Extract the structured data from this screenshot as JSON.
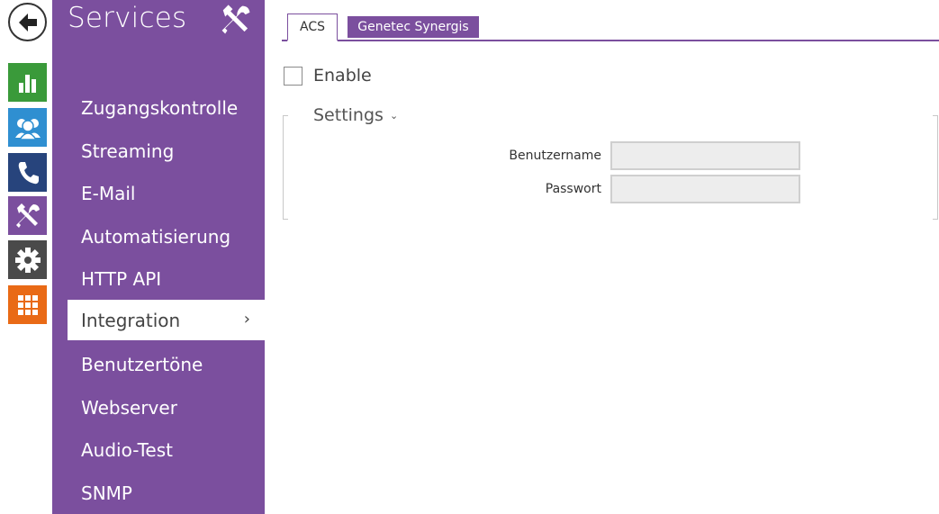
{
  "rail": {
    "back": {
      "icon": "back-arrow-icon"
    },
    "buttons": [
      {
        "icon": "status-chart-icon",
        "color": "#3a9a3a"
      },
      {
        "icon": "users-icon",
        "color": "#2f8fd1"
      },
      {
        "icon": "phone-icon",
        "color": "#27447c"
      },
      {
        "icon": "services-tools-icon",
        "color": "#7b4f9e"
      },
      {
        "icon": "system-gear-icon",
        "color": "#4a4a4a"
      },
      {
        "icon": "hardware-grid-icon",
        "color": "#e96a16"
      }
    ]
  },
  "menu": {
    "title": "Services",
    "title_icon": "tools-icon",
    "items": [
      {
        "label": "Zugangskontrolle"
      },
      {
        "label": "Streaming"
      },
      {
        "label": "E-Mail"
      },
      {
        "label": "Automatisierung"
      },
      {
        "label": "HTTP API"
      },
      {
        "label": "Integration",
        "active": true,
        "chevron": "›"
      },
      {
        "label": "Benutzertöne"
      },
      {
        "label": "Webserver"
      },
      {
        "label": "Audio-Test"
      },
      {
        "label": "SNMP"
      }
    ]
  },
  "tabs": [
    {
      "label": "ACS",
      "active": true
    },
    {
      "label": "Genetec Synergis",
      "active": false
    }
  ],
  "enable": {
    "label": "Enable",
    "checked": false
  },
  "settings": {
    "legend": "Settings",
    "caret": "⌄",
    "fields": [
      {
        "label": "Benutzername",
        "value": "",
        "placeholder": ""
      },
      {
        "label": "Passwort",
        "value": "",
        "placeholder": ""
      }
    ]
  },
  "colors": {
    "accent": "#7b4f9e",
    "menu_bg": "#7b4f9e"
  }
}
